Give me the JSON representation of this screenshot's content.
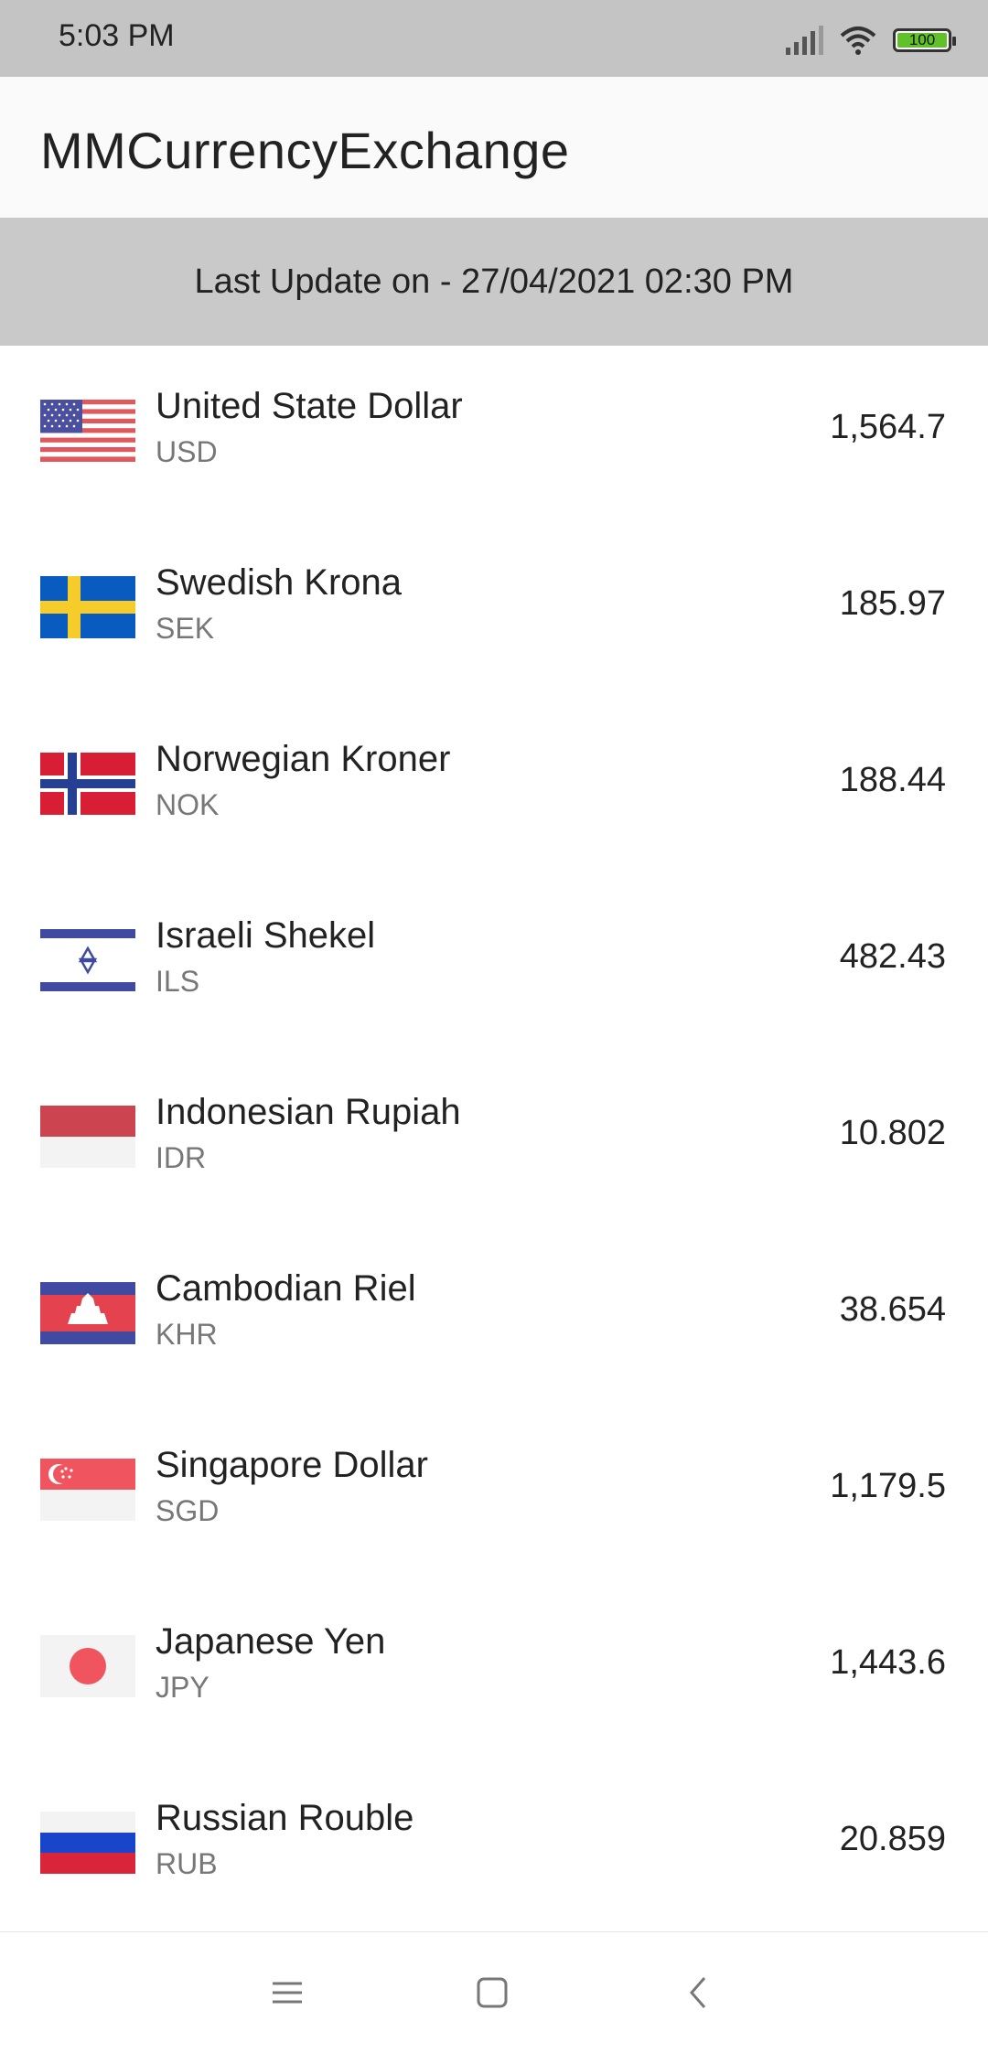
{
  "status_bar": {
    "time": "5:03 PM",
    "battery": "100"
  },
  "app_bar": {
    "title": "MMCurrencyExchange"
  },
  "update_banner": {
    "text": "Last Update on - 27/04/2021 02:30 PM"
  },
  "currencies": [
    {
      "name": "United State Dollar",
      "code": "USD",
      "rate": "1,564.7",
      "flag": "us-flag"
    },
    {
      "name": "Swedish Krona",
      "code": "SEK",
      "rate": "185.97",
      "flag": "sweden-flag"
    },
    {
      "name": "Norwegian Kroner",
      "code": "NOK",
      "rate": "188.44",
      "flag": "norway-flag"
    },
    {
      "name": "Israeli Shekel",
      "code": "ILS",
      "rate": "482.43",
      "flag": "israel-flag"
    },
    {
      "name": "Indonesian Rupiah",
      "code": "IDR",
      "rate": "10.802",
      "flag": "indonesia-flag"
    },
    {
      "name": "Cambodian Riel",
      "code": "KHR",
      "rate": "38.654",
      "flag": "cambodia-flag"
    },
    {
      "name": "Singapore Dollar",
      "code": "SGD",
      "rate": "1,179.5",
      "flag": "singapore-flag"
    },
    {
      "name": "Japanese Yen",
      "code": "JPY",
      "rate": "1,443.6",
      "flag": "japan-flag"
    },
    {
      "name": "Russian Rouble",
      "code": "RUB",
      "rate": "20.859",
      "flag": "russia-flag"
    }
  ],
  "nav_bar": {
    "icons": [
      "menu-icon",
      "home-icon",
      "back-icon"
    ]
  },
  "colors": {
    "status_bar": "#c4c4c4",
    "banner": "#c9c9c9",
    "app_bar": "#fafafa"
  }
}
